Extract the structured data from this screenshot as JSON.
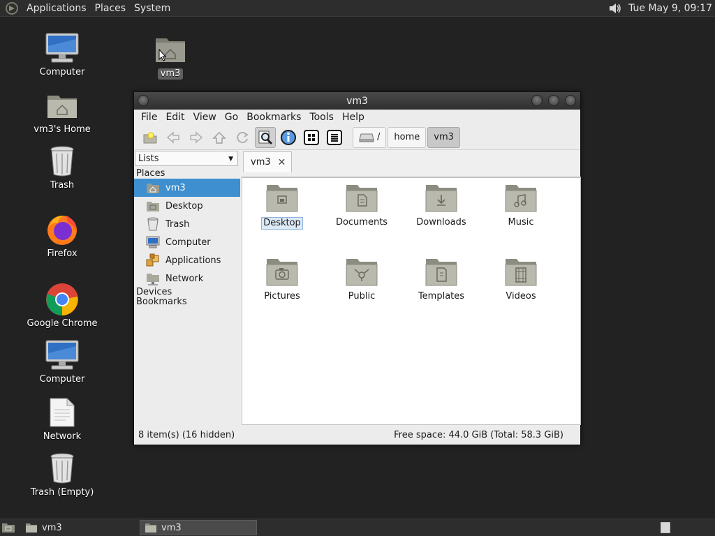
{
  "top_panel": {
    "menus": [
      "Applications",
      "Places",
      "System"
    ],
    "clock": "Tue May  9, 09:17"
  },
  "desktop_icons": [
    {
      "label": "Computer",
      "icon": "computer-icon"
    },
    {
      "label": "vm3's Home",
      "icon": "home-folder-icon"
    },
    {
      "label": "Trash",
      "icon": "trash-icon"
    },
    {
      "label": "Firefox",
      "icon": "firefox-icon"
    },
    {
      "label": "Google Chrome",
      "icon": "chrome-icon"
    },
    {
      "label": "Computer",
      "icon": "computer-icon"
    },
    {
      "label": "Network",
      "icon": "document-icon"
    },
    {
      "label": "Trash (Empty)",
      "icon": "trash-icon"
    },
    {
      "label": "vm3",
      "icon": "home-folder-icon"
    }
  ],
  "window": {
    "title": "vm3",
    "menubar": [
      "File",
      "Edit",
      "View",
      "Go",
      "Bookmarks",
      "Tools",
      "Help"
    ],
    "path": {
      "root": "/",
      "crumbs": [
        "home",
        "vm3"
      ]
    },
    "side_pane": {
      "selector": "Lists",
      "places_heading": "Places",
      "places": [
        {
          "label": "vm3",
          "icon": "home-icon",
          "selected": true
        },
        {
          "label": "Desktop",
          "icon": "desktop-icon"
        },
        {
          "label": "Trash",
          "icon": "trash-icon"
        },
        {
          "label": "Computer",
          "icon": "computer-icon"
        },
        {
          "label": "Applications",
          "icon": "applications-icon"
        },
        {
          "label": "Network",
          "icon": "network-icon"
        }
      ],
      "devices_heading": "Devices",
      "bookmarks_heading": "Bookmarks"
    },
    "tab": {
      "label": "vm3"
    },
    "files": [
      {
        "label": "Desktop",
        "icon": "desktop-folder-icon",
        "selected": true
      },
      {
        "label": "Documents",
        "icon": "documents-folder-icon"
      },
      {
        "label": "Downloads",
        "icon": "downloads-folder-icon"
      },
      {
        "label": "Music",
        "icon": "music-folder-icon"
      },
      {
        "label": "Pictures",
        "icon": "pictures-folder-icon"
      },
      {
        "label": "Public",
        "icon": "public-folder-icon"
      },
      {
        "label": "Templates",
        "icon": "templates-folder-icon"
      },
      {
        "label": "Videos",
        "icon": "videos-folder-icon"
      }
    ],
    "status": {
      "items": "8 item(s) (16 hidden)",
      "free_space": "Free space: 44.0 GiB (Total: 58.3 GiB)"
    }
  },
  "taskbar": {
    "tasks": [
      {
        "label": "vm3"
      },
      {
        "label": "vm3",
        "active": true
      }
    ]
  },
  "colors": {
    "selection": "#3d8fd0",
    "panel": "#2d2d2d",
    "desktop": "#222222"
  }
}
